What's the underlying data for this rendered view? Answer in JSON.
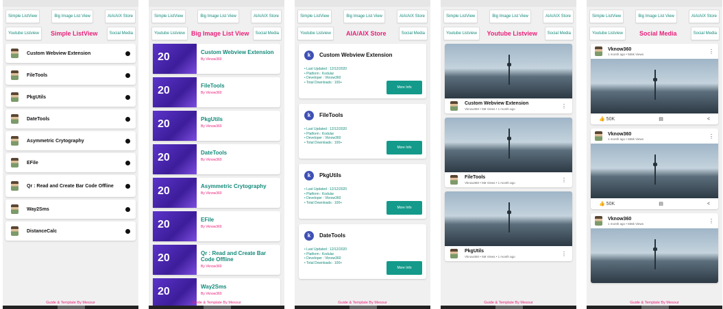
{
  "tabs_row1": [
    "Simple ListView",
    "Big Image List View",
    "AIA/AIX Store"
  ],
  "tabs_row2_left": "Youtube Listview",
  "tabs_row2_right": "Social Media",
  "screens": {
    "simple": {
      "active": "Simple ListView",
      "items": [
        "Custom Webview Extension",
        "FileTools",
        "PkgUtils",
        "DateTools",
        "Asymmetric Crytography",
        "EFile",
        "Qr : Read and Create Bar Code Offline",
        "Way2Sms",
        "DistanceCalc"
      ]
    },
    "bigimage": {
      "active": "Big Image List View",
      "thumb_number": "20",
      "items": [
        "Custom Webview Extension",
        "FileTools",
        "PkgUtils",
        "DateTools",
        "Asymmetric Crytography",
        "EFile",
        "Qr : Read and Create Bar Code Offline",
        "Way2Sms"
      ],
      "by": "By Vknow360"
    },
    "store": {
      "active": "AIA/AIX Store",
      "icon": "k-icon",
      "items": [
        {
          "title": "Custom Webview Extension",
          "meta": [
            "• Last Updated : 12/12/2020",
            "• Platform : Kodular",
            "• Developer : Vknow360",
            "• Total Downloads : 100+"
          ]
        },
        {
          "title": "FileTools",
          "meta": [
            "• Last Updated : 12/12/2020",
            "• Platform : Kodular",
            "• Developer : Vknow360",
            "• Total Downloads : 100+"
          ]
        },
        {
          "title": "PkgUtils",
          "meta": [
            "• Last Updated : 12/12/2020",
            "• Platform : Kodular",
            "• Developer : Vknow360",
            "• Total Downloads : 100+"
          ]
        },
        {
          "title": "DateTools",
          "meta": [
            "• Last Updated : 12/12/2020",
            "• Platform : Kodular",
            "• Developer : Vknow360",
            "• Total Downloads : 100+"
          ]
        }
      ],
      "button": "More Info"
    },
    "youtube": {
      "active": "Youtube Listview",
      "items": [
        {
          "title": "Custom Webview Extension",
          "sub": "Vknow360 • 5M Views • 1 month ago"
        },
        {
          "title": "FileTools",
          "sub": "Vknow360 • 5M Views • 1 month ago"
        },
        {
          "title": "PkgUtils",
          "sub": "Vknow360 • 5M Views • 1 month ago"
        }
      ]
    },
    "social": {
      "active": "Social Media",
      "items": [
        {
          "name": "Vknow360",
          "sub": "1 month ago • 555k Views",
          "likes": "50K"
        },
        {
          "name": "Vknow360",
          "sub": "1 month ago • 555k Views",
          "likes": "50K"
        },
        {
          "name": "Vknow360",
          "sub": "1 month ago • 555k Views",
          "likes": ""
        }
      ]
    }
  },
  "footer": "Guide & Template By Mesour",
  "colors": {
    "accent": "#e91e7a",
    "teal": "#138a7a",
    "button": "#139a8a",
    "thumb": "#5b34c9"
  }
}
